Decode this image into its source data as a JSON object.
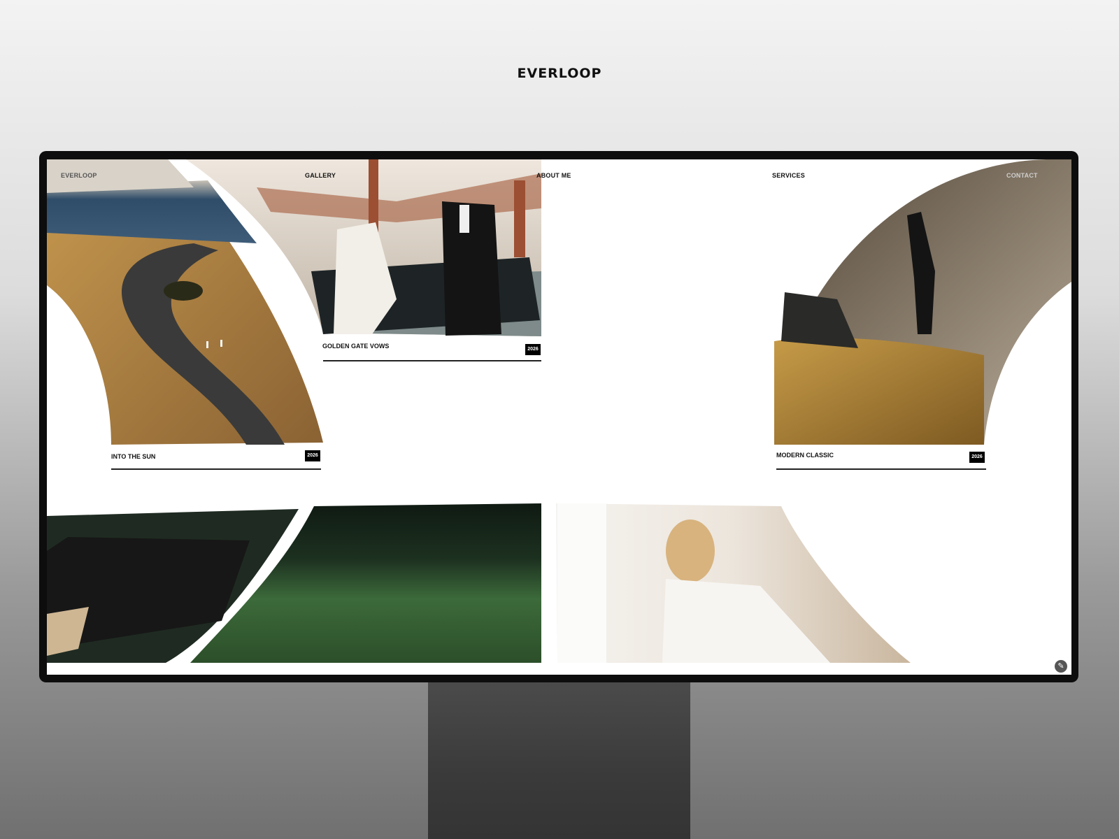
{
  "brand": {
    "title": "EVERLOOP"
  },
  "nav": {
    "logo": "EVERLOOP",
    "items": [
      "GALLERY",
      "ABOUT ME",
      "SERVICES",
      "CONTACT"
    ]
  },
  "gallery": {
    "cards": [
      {
        "title": "INTO THE SUN",
        "year": "2026"
      },
      {
        "title": "GOLDEN GATE VOWS",
        "year": "2026"
      },
      {
        "title": "MODERN CLASSIC",
        "year": "2026"
      }
    ]
  },
  "icons": {
    "edit": "pencil-icon"
  },
  "colors": {
    "background": "#ffffff",
    "text": "#111111",
    "badge": "#000000"
  }
}
